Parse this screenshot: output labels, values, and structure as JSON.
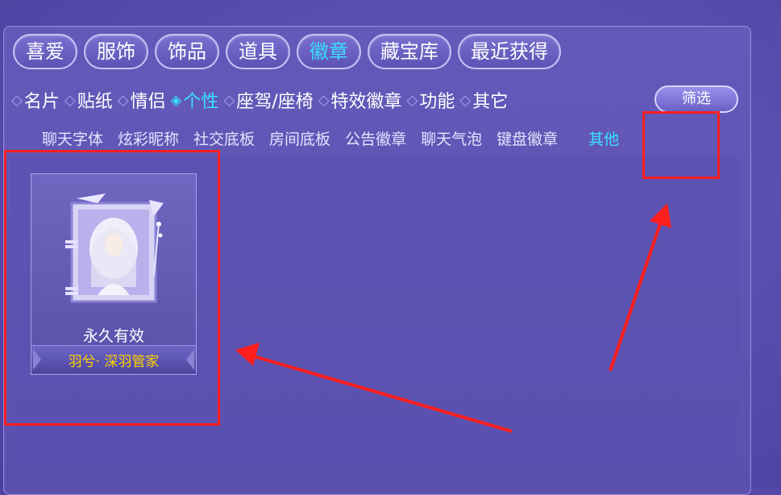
{
  "tabs": [
    "喜爱",
    "服饰",
    "饰品",
    "道具",
    "徽章",
    "藏宝库",
    "最近获得"
  ],
  "active_tab": "徽章",
  "subtabs": [
    "名片",
    "贴纸",
    "情侣",
    "个性",
    "座驾/座椅",
    "特效徽章",
    "功能",
    "其它"
  ],
  "active_subtab": "个性",
  "filter_label": "筛选",
  "categories": [
    "聊天字体",
    "炫彩昵称",
    "社交底板",
    "房间底板",
    "公告徽章",
    "聊天气泡",
    "键盘徽章",
    "其他"
  ],
  "active_category": "其他",
  "item": {
    "validity": "永久有效",
    "name": "羽兮· 深羽管家"
  },
  "colors": {
    "accent": "#37e0ff",
    "highlight": "#ff1f1f",
    "item_name": "#ffd400"
  }
}
